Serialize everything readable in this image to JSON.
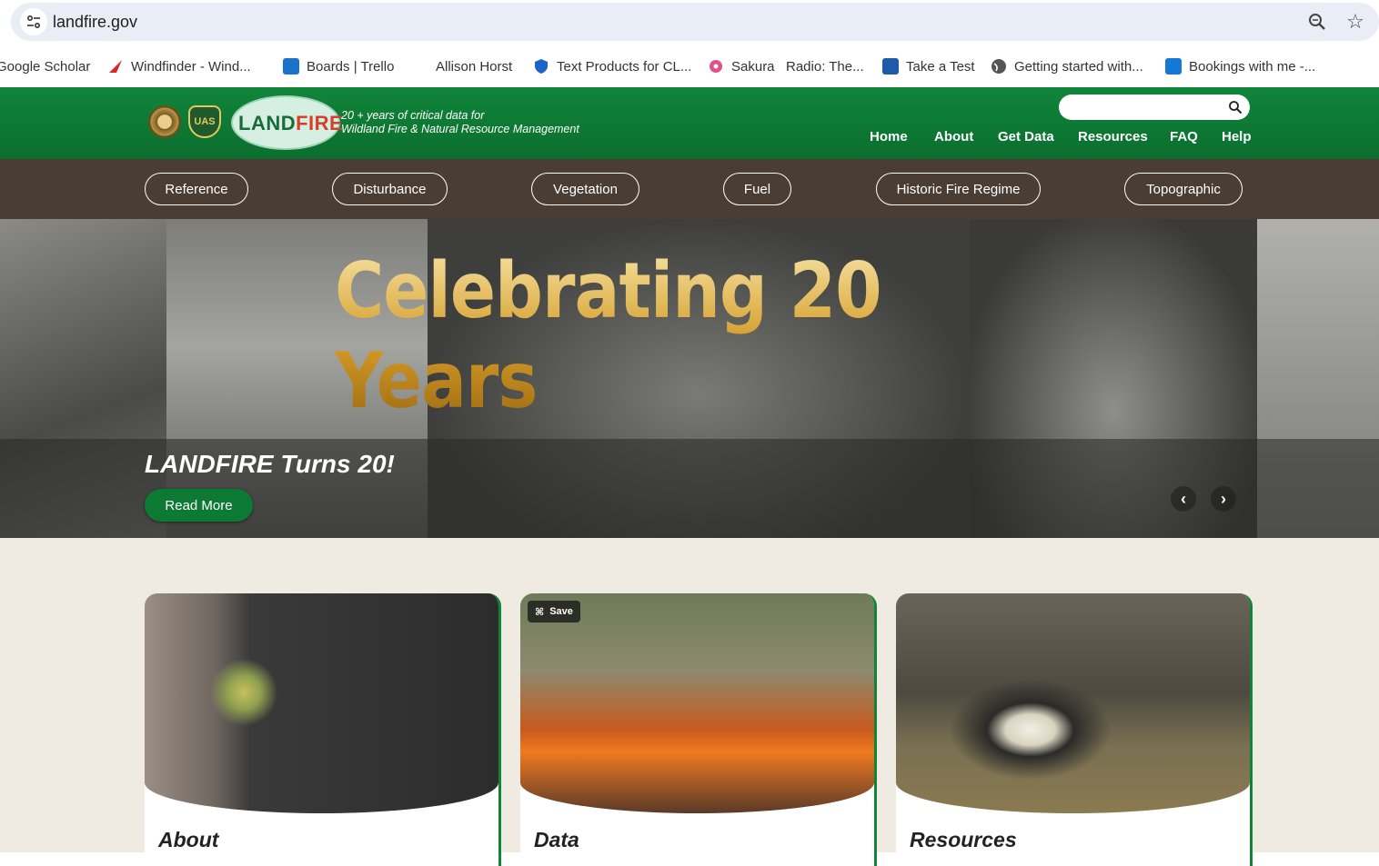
{
  "browser": {
    "url": "landfire.gov",
    "bookmarks": [
      {
        "label": "Google Scholar",
        "icon": "scholar-icon"
      },
      {
        "label": "Windfinder - Wind...",
        "icon": "windfinder-icon"
      },
      {
        "label": "Boards | Trello",
        "icon": "trello-icon"
      },
      {
        "label": "Allison Horst",
        "icon": ""
      },
      {
        "label": "Text Products for CL...",
        "icon": "shield-icon"
      },
      {
        "label": "Sakura",
        "icon": "flower-icon"
      },
      {
        "label": "Radio: The...",
        "icon": ""
      },
      {
        "label": "Take a Test",
        "icon": "test-icon"
      },
      {
        "label": "Getting started with...",
        "icon": "globe-icon"
      },
      {
        "label": "Bookings with me -...",
        "icon": "outlook-icon"
      }
    ]
  },
  "header": {
    "logo_text_a": "LAND",
    "logo_text_b": "FIRE",
    "seal2_text": "UAS",
    "tagline_1": "20 + years of critical data for",
    "tagline_2": "Wildland Fire & Natural Resource Management",
    "search_placeholder": "",
    "nav": [
      "Home",
      "About",
      "Get Data",
      "Resources",
      "FAQ",
      "Help"
    ]
  },
  "categories": [
    "Reference",
    "Disturbance",
    "Vegetation",
    "Fuel",
    "Historic Fire Regime",
    "Topographic"
  ],
  "hero": {
    "headline": "Celebrating 20 Years",
    "caption": "LANDFIRE Turns 20!",
    "button": "Read More",
    "prev": "‹",
    "next": "›"
  },
  "cards": [
    {
      "title": "About"
    },
    {
      "title": "Data",
      "save_label": "Save"
    },
    {
      "title": "Resources"
    }
  ],
  "colors": {
    "brand_green": "#10853a",
    "category_bar": "#493d34",
    "content_bg": "#efeae2"
  }
}
